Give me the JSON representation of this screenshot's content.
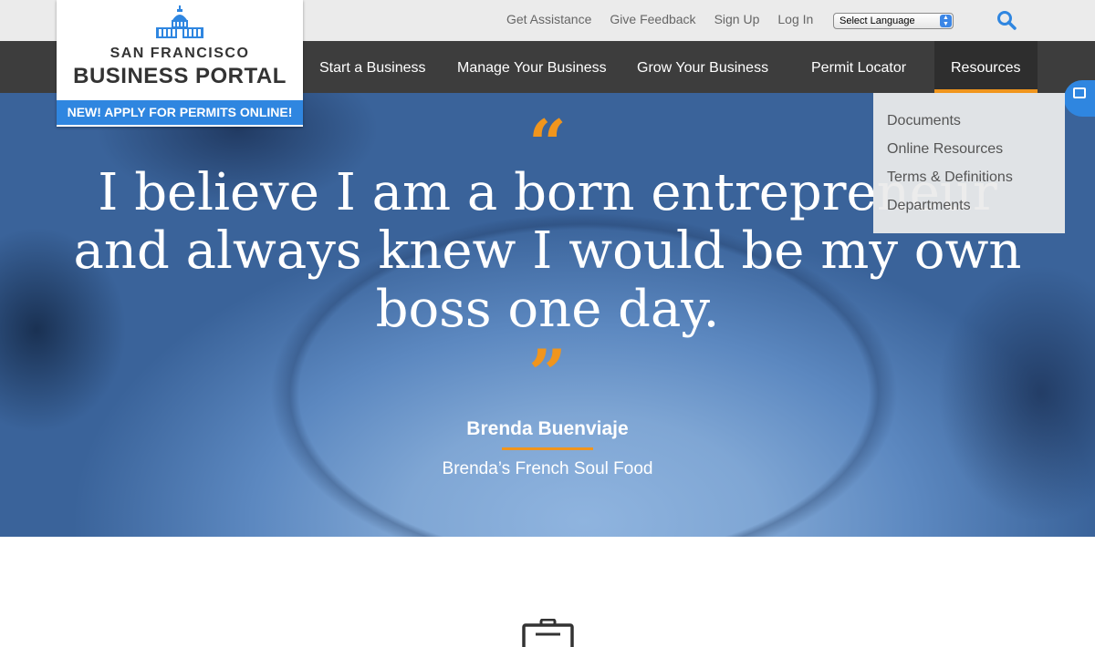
{
  "utility": {
    "links": [
      "Get Assistance",
      "Give Feedback",
      "Sign Up",
      "Log In"
    ],
    "language_select": "Select Language"
  },
  "logo": {
    "line1": "SAN FRANCISCO",
    "line2": "BUSINESS PORTAL",
    "banner": "NEW! APPLY FOR PERMITS ONLINE!"
  },
  "nav": {
    "items": [
      "Start a Business",
      "Manage Your Business",
      "Grow Your Business",
      "Permit Locator",
      "Resources"
    ]
  },
  "dropdown": {
    "items": [
      "Documents",
      "Online Resources",
      "Terms & Definitions",
      "Departments"
    ]
  },
  "hero": {
    "open_quote": "“",
    "quote": "I believe I am a born entrepreneur and always knew I would be my own boss one day.",
    "close_quote": "”",
    "name": "Brenda Buenviaje",
    "business": "Brenda’s French Soul Food"
  },
  "colors": {
    "accent": "#f0951d",
    "brand_blue": "#2f86e0",
    "nav_bg": "#3d3d3d"
  }
}
